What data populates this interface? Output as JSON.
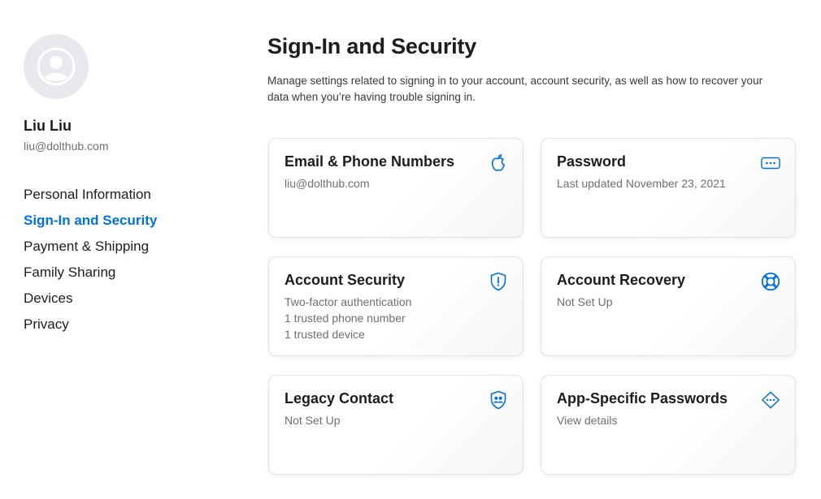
{
  "user": {
    "name": "Liu Liu",
    "email": "liu@dolthub.com"
  },
  "sidebar": {
    "items": [
      {
        "label": "Personal Information"
      },
      {
        "label": "Sign-In and Security"
      },
      {
        "label": "Payment & Shipping"
      },
      {
        "label": "Family Sharing"
      },
      {
        "label": "Devices"
      },
      {
        "label": "Privacy"
      }
    ],
    "active_index": 1
  },
  "main": {
    "title": "Sign-In and Security",
    "description": "Manage settings related to signing in to your account, account security, as well as how to recover your data when you’re having trouble signing in.",
    "cards": [
      {
        "title": "Email & Phone Numbers",
        "lines": [
          "liu@dolthub.com"
        ],
        "icon": "apple-icon"
      },
      {
        "title": "Password",
        "lines": [
          "Last updated November 23, 2021"
        ],
        "icon": "password-dots-icon"
      },
      {
        "title": "Account Security",
        "lines": [
          "Two-factor authentication",
          "1 trusted phone number",
          "1 trusted device"
        ],
        "icon": "shield-exclamation-icon"
      },
      {
        "title": "Account Recovery",
        "lines": [
          "Not Set Up"
        ],
        "icon": "lifebuoy-icon"
      },
      {
        "title": "Legacy Contact",
        "lines": [
          "Not Set Up"
        ],
        "icon": "legacy-contact-shield-icon"
      },
      {
        "title": "App-Specific Passwords",
        "lines": [
          "View details"
        ],
        "icon": "key-diamond-icon"
      }
    ]
  },
  "colors": {
    "accent": "#0071e3",
    "text_primary": "#1d1d1f",
    "text_secondary": "#6e6e73",
    "avatar_bg": "#e8e8ed"
  }
}
